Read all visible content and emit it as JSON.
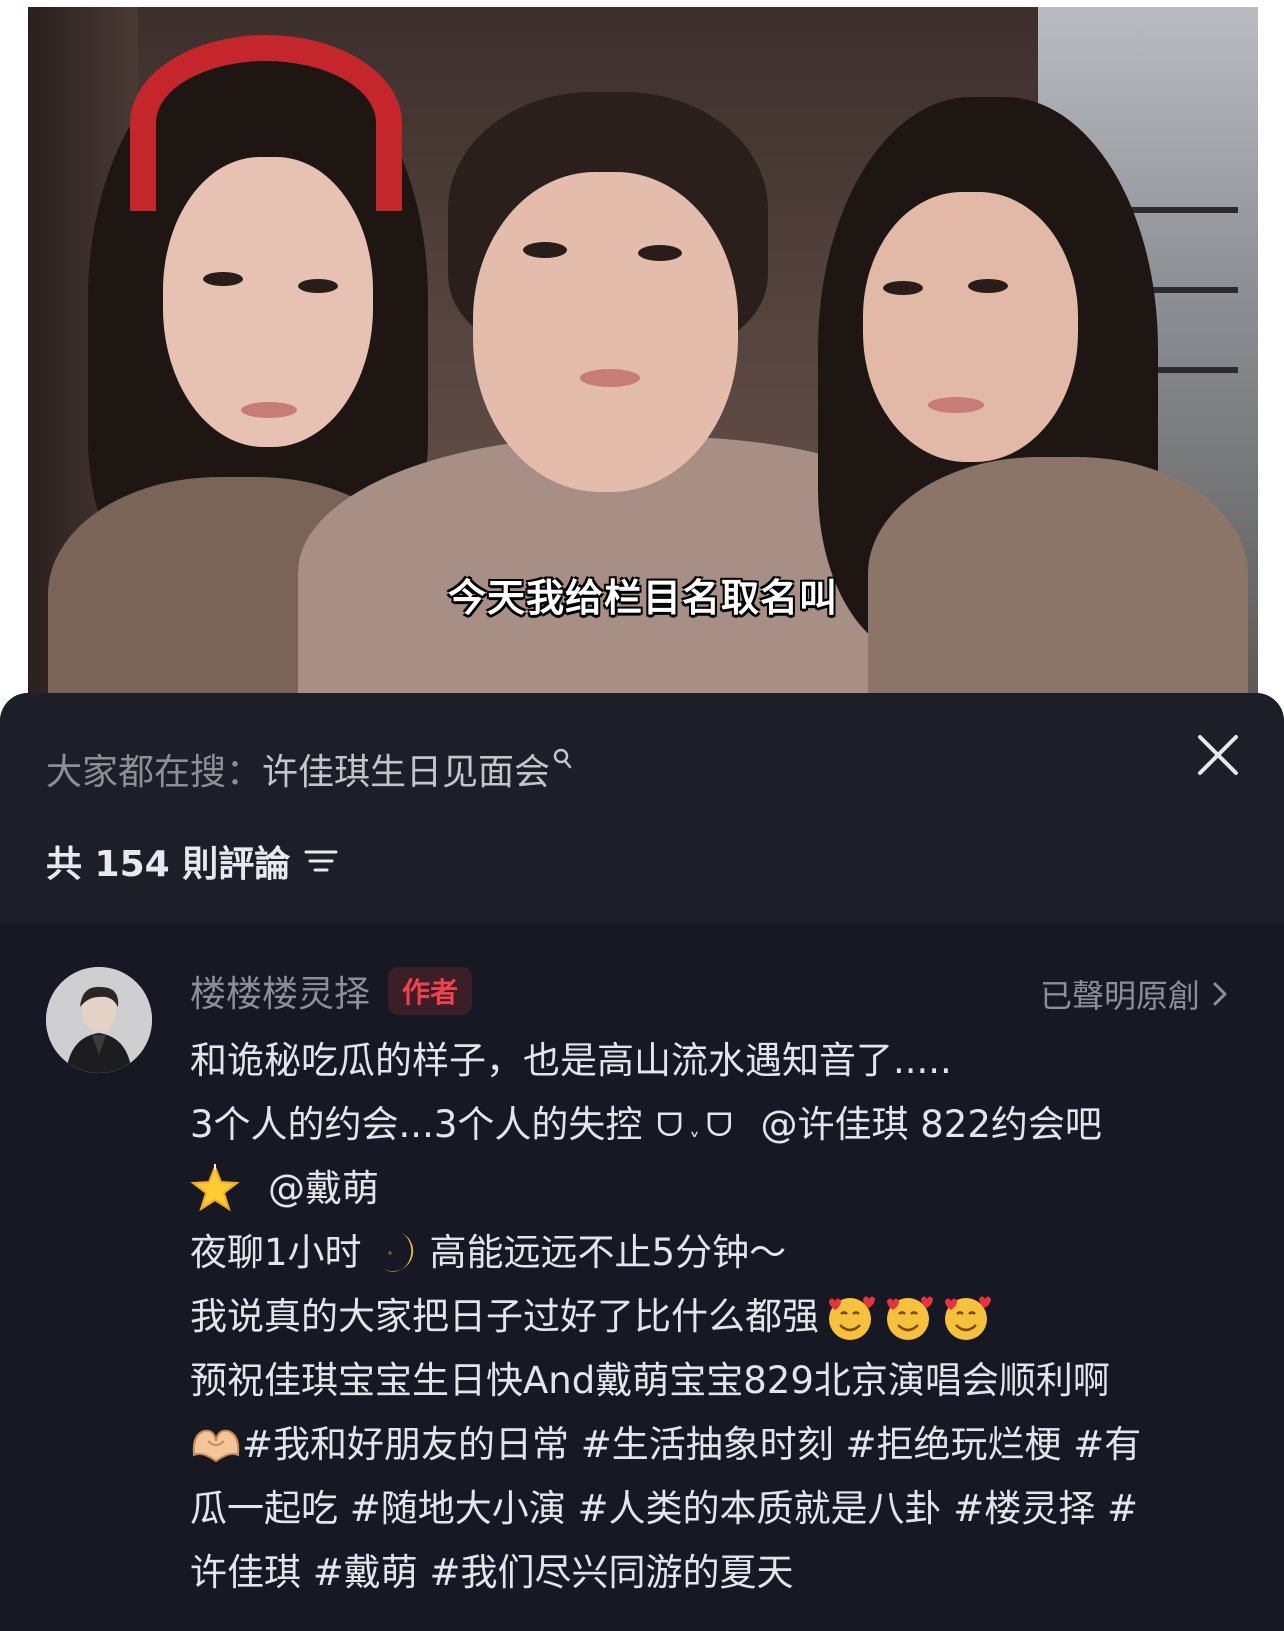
{
  "video": {
    "subtitle": "今天我给栏目名取名叫"
  },
  "panel": {
    "search_prefix": "大家都在搜：",
    "search_term": "许佳琪生日见面会",
    "search_icon": "search-icon",
    "close_icon": "close-icon",
    "comment_count_label": "共 154 則評論",
    "sort_icon": "sort-icon"
  },
  "comment": {
    "author": "楼楼楼灵择",
    "badge": "作者",
    "original_claim": "已聲明原創",
    "lines": {
      "l1": "和诡秘吃瓜的样子，也是高山流水遇知音了.....",
      "l2a": "3个人的约会...3个人的失控",
      "l2_kaomoji_left": "ᗜ",
      "l2_kaomoji_mid": "ˬ",
      "l2_kaomoji_right": "ᗜ",
      "l2b": "@许佳琪 822约会吧",
      "l3": "@戴萌",
      "l4a": "夜聊1小时",
      "l4b": "高能远远不止5分钟～",
      "l5": "我说真的大家把日子过好了比什么都强",
      "l6": "预祝佳琪宝宝生日快And戴萌宝宝829北京演唱会顺利啊",
      "l7": "#我和好朋友的日常 #生活抽象时刻 #拒绝玩烂梗 #有",
      "l8": "瓜一起吃 #随地大小演 #人类的本质就是八卦 #楼灵择 #",
      "l9": "许佳琪 #戴萌 #我们尽兴同游的夏天"
    },
    "emojis": [
      "star-emoji",
      "crescent-moon-emoji",
      "smiling-face-with-hearts-emoji",
      "heart-hands-emoji"
    ]
  },
  "colors": {
    "panel_bg": "#161823",
    "badge_text": "#f1414f",
    "muted_text": "#8d8f97",
    "body_text": "#e4e5ea"
  }
}
